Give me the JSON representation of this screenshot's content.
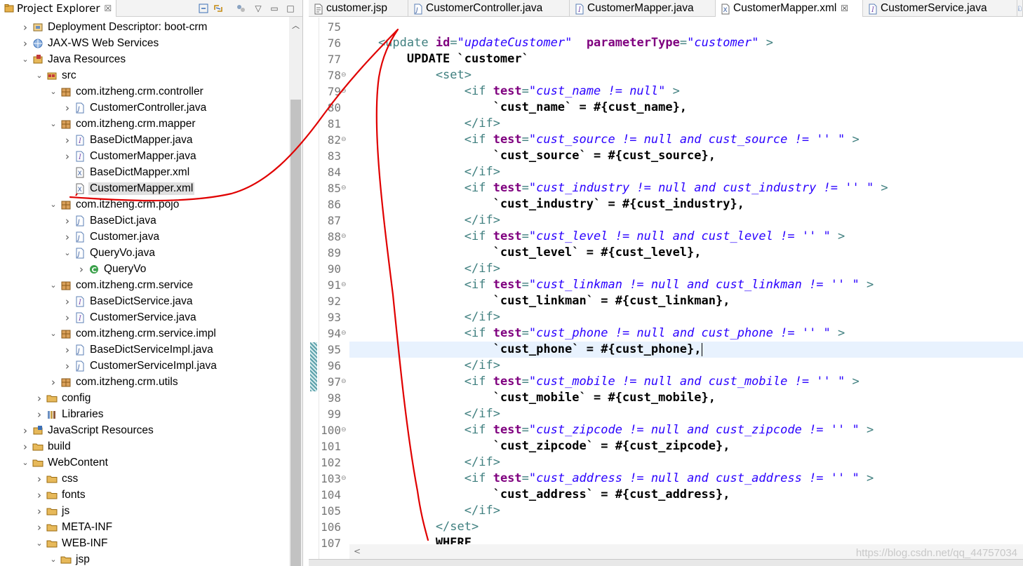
{
  "explorer": {
    "title": "Project Explorer",
    "items": [
      {
        "label": "Deployment Descriptor: boot-crm",
        "icon": "deployment-descriptor-icon",
        "twisty": "collapsed",
        "indent": 0
      },
      {
        "label": "JAX-WS Web Services",
        "icon": "web-services-icon",
        "twisty": "collapsed",
        "indent": 0
      },
      {
        "label": "Java Resources",
        "icon": "java-resources-icon",
        "twisty": "expanded",
        "indent": 0
      },
      {
        "label": "src",
        "icon": "source-folder-icon",
        "twisty": "expanded",
        "indent": 1
      },
      {
        "label": "com.itzheng.crm.controller",
        "icon": "package-icon",
        "twisty": "expanded",
        "indent": 2
      },
      {
        "label": "CustomerController.java",
        "icon": "java-file-icon",
        "twisty": "collapsed",
        "indent": 3
      },
      {
        "label": "com.itzheng.crm.mapper",
        "icon": "package-icon",
        "twisty": "expanded",
        "indent": 2
      },
      {
        "label": "BaseDictMapper.java",
        "icon": "java-interface-icon",
        "twisty": "collapsed",
        "indent": 3
      },
      {
        "label": "CustomerMapper.java",
        "icon": "java-interface-icon",
        "twisty": "collapsed",
        "indent": 3
      },
      {
        "label": "BaseDictMapper.xml",
        "icon": "xml-file-icon",
        "twisty": "none",
        "indent": 3
      },
      {
        "label": "CustomerMapper.xml",
        "icon": "xml-file-icon",
        "twisty": "none",
        "indent": 3,
        "selected": true
      },
      {
        "label": "com.itzheng.crm.pojo",
        "icon": "package-icon",
        "twisty": "expanded",
        "indent": 2
      },
      {
        "label": "BaseDict.java",
        "icon": "java-file-icon",
        "twisty": "collapsed",
        "indent": 3
      },
      {
        "label": "Customer.java",
        "icon": "java-file-icon",
        "twisty": "collapsed",
        "indent": 3
      },
      {
        "label": "QueryVo.java",
        "icon": "java-file-icon",
        "twisty": "expanded",
        "indent": 3
      },
      {
        "label": "QueryVo",
        "icon": "class-icon",
        "twisty": "collapsed",
        "indent": 4
      },
      {
        "label": "com.itzheng.crm.service",
        "icon": "package-icon",
        "twisty": "expanded",
        "indent": 2
      },
      {
        "label": "BaseDictService.java",
        "icon": "java-interface-icon",
        "twisty": "collapsed",
        "indent": 3
      },
      {
        "label": "CustomerService.java",
        "icon": "java-interface-icon",
        "twisty": "collapsed",
        "indent": 3
      },
      {
        "label": "com.itzheng.crm.service.impl",
        "icon": "package-icon",
        "twisty": "expanded",
        "indent": 2
      },
      {
        "label": "BaseDictServiceImpl.java",
        "icon": "java-file-icon",
        "twisty": "collapsed",
        "indent": 3
      },
      {
        "label": "CustomerServiceImpl.java",
        "icon": "java-file-icon",
        "twisty": "collapsed",
        "indent": 3
      },
      {
        "label": "com.itzheng.crm.utils",
        "icon": "package-icon",
        "twisty": "collapsed",
        "indent": 2
      },
      {
        "label": "config",
        "icon": "folder-icon",
        "twisty": "collapsed",
        "indent": 1
      },
      {
        "label": "Libraries",
        "icon": "libraries-icon",
        "twisty": "collapsed",
        "indent": 1
      },
      {
        "label": "JavaScript Resources",
        "icon": "javascript-resources-icon",
        "twisty": "collapsed",
        "indent": 0
      },
      {
        "label": "build",
        "icon": "folder-icon",
        "twisty": "collapsed",
        "indent": 0
      },
      {
        "label": "WebContent",
        "icon": "folder-icon",
        "twisty": "expanded",
        "indent": 0
      },
      {
        "label": "css",
        "icon": "folder-icon",
        "twisty": "collapsed",
        "indent": 1
      },
      {
        "label": "fonts",
        "icon": "folder-icon",
        "twisty": "collapsed",
        "indent": 1
      },
      {
        "label": "js",
        "icon": "folder-icon",
        "twisty": "collapsed",
        "indent": 1
      },
      {
        "label": "META-INF",
        "icon": "folder-icon",
        "twisty": "collapsed",
        "indent": 1
      },
      {
        "label": "WEB-INF",
        "icon": "folder-icon",
        "twisty": "expanded",
        "indent": 1
      },
      {
        "label": "jsp",
        "icon": "folder-icon",
        "twisty": "expanded",
        "indent": 2
      }
    ]
  },
  "editor_tabs": [
    {
      "label": "customer.jsp",
      "icon": "jsp-file-icon",
      "active": false
    },
    {
      "label": "CustomerController.java",
      "icon": "java-file-icon",
      "active": false
    },
    {
      "label": "CustomerMapper.java",
      "icon": "java-interface-icon",
      "active": false
    },
    {
      "label": "CustomerMapper.xml",
      "icon": "xml-file-icon",
      "active": true,
      "close": "☒"
    },
    {
      "label": "CustomerService.java",
      "icon": "java-interface-icon",
      "active": false
    }
  ],
  "code_lines": [
    {
      "n": "75",
      "fold": false,
      "parts": []
    },
    {
      "n": "76",
      "fold": false,
      "parts": [
        [
          "k",
          "    <update "
        ],
        [
          "a",
          "id"
        ],
        [
          "k",
          "="
        ],
        [
          "s",
          "\"updateCustomer\""
        ],
        [
          "k",
          "  "
        ],
        [
          "a",
          "parameterType"
        ],
        [
          "k",
          "="
        ],
        [
          "s",
          "\"customer\""
        ],
        [
          "k",
          " >"
        ]
      ]
    },
    {
      "n": "77",
      "fold": false,
      "parts": [
        [
          "t",
          "        UPDATE `customer`"
        ]
      ]
    },
    {
      "n": "78",
      "fold": true,
      "parts": [
        [
          "k",
          "            <set>"
        ]
      ]
    },
    {
      "n": "79",
      "fold": true,
      "parts": [
        [
          "k",
          "                <if "
        ],
        [
          "a",
          "test"
        ],
        [
          "k",
          "="
        ],
        [
          "s",
          "\"cust_name != null\""
        ],
        [
          "k",
          " >"
        ]
      ]
    },
    {
      "n": "80",
      "fold": false,
      "parts": [
        [
          "t",
          "                    `cust_name` = #{cust_name},"
        ]
      ]
    },
    {
      "n": "81",
      "fold": false,
      "parts": [
        [
          "k",
          "                </if>"
        ]
      ]
    },
    {
      "n": "82",
      "fold": true,
      "parts": [
        [
          "k",
          "                <if "
        ],
        [
          "a",
          "test"
        ],
        [
          "k",
          "="
        ],
        [
          "s",
          "\"cust_source != null and cust_source != '' \""
        ],
        [
          "k",
          " >"
        ]
      ]
    },
    {
      "n": "83",
      "fold": false,
      "parts": [
        [
          "t",
          "                    `cust_source` = #{cust_source},"
        ]
      ]
    },
    {
      "n": "84",
      "fold": false,
      "parts": [
        [
          "k",
          "                </if>"
        ]
      ]
    },
    {
      "n": "85",
      "fold": true,
      "parts": [
        [
          "k",
          "                <if "
        ],
        [
          "a",
          "test"
        ],
        [
          "k",
          "="
        ],
        [
          "s",
          "\"cust_industry != null and cust_industry != '' \""
        ],
        [
          "k",
          " >"
        ]
      ]
    },
    {
      "n": "86",
      "fold": false,
      "parts": [
        [
          "t",
          "                    `cust_industry` = #{cust_industry},"
        ]
      ]
    },
    {
      "n": "87",
      "fold": false,
      "parts": [
        [
          "k",
          "                </if>"
        ]
      ]
    },
    {
      "n": "88",
      "fold": true,
      "parts": [
        [
          "k",
          "                <if "
        ],
        [
          "a",
          "test"
        ],
        [
          "k",
          "="
        ],
        [
          "s",
          "\"cust_level != null and cust_level != '' \""
        ],
        [
          "k",
          " >"
        ]
      ]
    },
    {
      "n": "89",
      "fold": false,
      "parts": [
        [
          "t",
          "                    `cust_level` = #{cust_level},"
        ]
      ]
    },
    {
      "n": "90",
      "fold": false,
      "parts": [
        [
          "k",
          "                </if>"
        ]
      ]
    },
    {
      "n": "91",
      "fold": true,
      "parts": [
        [
          "k",
          "                <if "
        ],
        [
          "a",
          "test"
        ],
        [
          "k",
          "="
        ],
        [
          "s",
          "\"cust_linkman != null and cust_linkman != '' \""
        ],
        [
          "k",
          " >"
        ]
      ]
    },
    {
      "n": "92",
      "fold": false,
      "parts": [
        [
          "t",
          "                    `cust_linkman` = #{cust_linkman},"
        ]
      ]
    },
    {
      "n": "93",
      "fold": false,
      "parts": [
        [
          "k",
          "                </if>"
        ]
      ]
    },
    {
      "n": "94",
      "fold": true,
      "parts": [
        [
          "k",
          "                <if "
        ],
        [
          "a",
          "test"
        ],
        [
          "k",
          "="
        ],
        [
          "s",
          "\"cust_phone != null and cust_phone != '' \""
        ],
        [
          "k",
          " >"
        ]
      ]
    },
    {
      "n": "95",
      "fold": false,
      "current": true,
      "parts": [
        [
          "t",
          "                    `cust_phone` = #{cust_phone},"
        ]
      ]
    },
    {
      "n": "96",
      "fold": false,
      "parts": [
        [
          "k",
          "                </if>"
        ]
      ]
    },
    {
      "n": "97",
      "fold": true,
      "parts": [
        [
          "k",
          "                <if "
        ],
        [
          "a",
          "test"
        ],
        [
          "k",
          "="
        ],
        [
          "s",
          "\"cust_mobile != null and cust_mobile != '' \""
        ],
        [
          "k",
          " >"
        ]
      ]
    },
    {
      "n": "98",
      "fold": false,
      "parts": [
        [
          "t",
          "                    `cust_mobile` = #{cust_mobile},"
        ]
      ]
    },
    {
      "n": "99",
      "fold": false,
      "parts": [
        [
          "k",
          "                </if>"
        ]
      ]
    },
    {
      "n": "100",
      "fold": true,
      "parts": [
        [
          "k",
          "                <if "
        ],
        [
          "a",
          "test"
        ],
        [
          "k",
          "="
        ],
        [
          "s",
          "\"cust_zipcode != null and cust_zipcode != '' \""
        ],
        [
          "k",
          " >"
        ]
      ]
    },
    {
      "n": "101",
      "fold": false,
      "parts": [
        [
          "t",
          "                    `cust_zipcode` = #{cust_zipcode},"
        ]
      ]
    },
    {
      "n": "102",
      "fold": false,
      "parts": [
        [
          "k",
          "                </if>"
        ]
      ]
    },
    {
      "n": "103",
      "fold": true,
      "parts": [
        [
          "k",
          "                <if "
        ],
        [
          "a",
          "test"
        ],
        [
          "k",
          "="
        ],
        [
          "s",
          "\"cust_address != null and cust_address != '' \""
        ],
        [
          "k",
          " >"
        ]
      ]
    },
    {
      "n": "104",
      "fold": false,
      "parts": [
        [
          "t",
          "                    `cust_address` = #{cust_address},"
        ]
      ]
    },
    {
      "n": "105",
      "fold": false,
      "parts": [
        [
          "k",
          "                </if>"
        ]
      ]
    },
    {
      "n": "106",
      "fold": false,
      "parts": [
        [
          "k",
          "            </set>"
        ]
      ]
    },
    {
      "n": "107",
      "fold": false,
      "parts": [
        [
          "t",
          "            WHERE"
        ]
      ]
    }
  ],
  "watermark": "https://blog.csdn.net/qq_44757034",
  "colors": {
    "tag": "#3f7f7f",
    "attribute": "#7f007f",
    "value": "#2a00ff",
    "annotation": "#e00000",
    "current_line": "#e8f2fe"
  }
}
